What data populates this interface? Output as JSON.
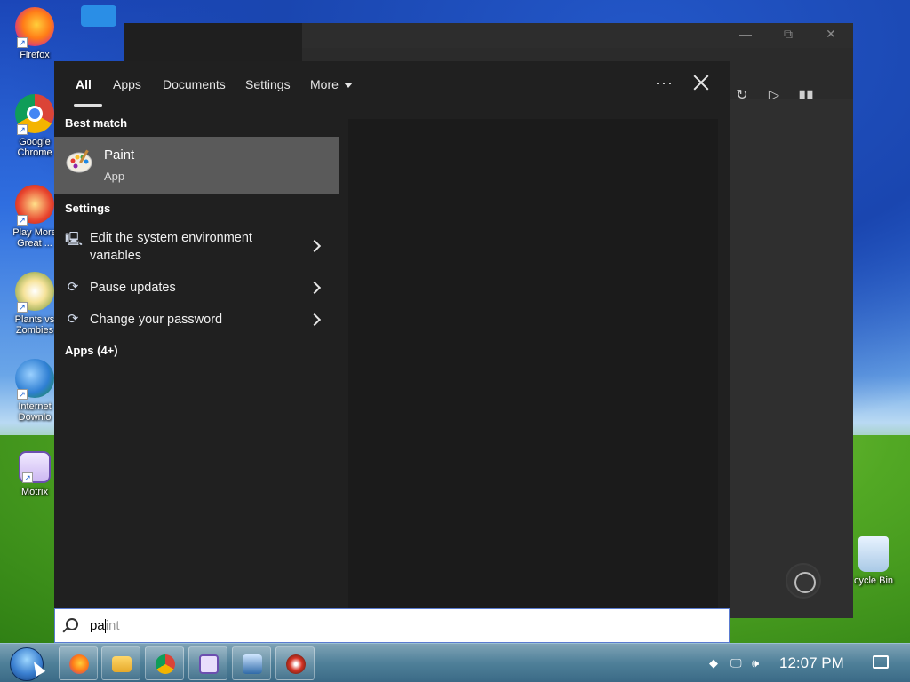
{
  "desktop": {
    "icons": [
      {
        "label": "Firefox"
      },
      {
        "label": "Google Chrome"
      },
      {
        "label": "Play More Great ..."
      },
      {
        "label": "Plants vs Zombies"
      },
      {
        "label": "Internet Downlo"
      },
      {
        "label": "Motrix"
      },
      {
        "label": "cycle Bin"
      }
    ]
  },
  "search": {
    "tabs": [
      {
        "label": "All"
      },
      {
        "label": "Apps"
      },
      {
        "label": "Documents"
      },
      {
        "label": "Settings"
      },
      {
        "label": "More"
      }
    ],
    "more_dots": "···",
    "best_match_heading": "Best match",
    "best_match": {
      "name": "Paint",
      "type": "App"
    },
    "settings_heading": "Settings",
    "settings_items": [
      {
        "label": "Edit the system environment variables"
      },
      {
        "label": "Pause updates"
      },
      {
        "label": "Change your password"
      }
    ],
    "apps_heading": "Apps (4+)",
    "query_typed": "pa",
    "query_ghost": "int"
  },
  "taskbar": {
    "clock": "12:07 PM"
  },
  "colors": {
    "panel_bg": "#202020",
    "selected_bg": "#5a5a5a",
    "accent": "#3a7fd0"
  }
}
